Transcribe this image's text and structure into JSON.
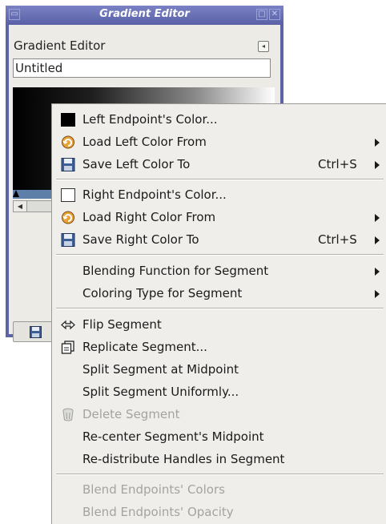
{
  "window": {
    "title": "Gradient Editor",
    "panel_label": "Gradient Editor",
    "name_value": "Untitled",
    "colors": {
      "titlebar": "#5c64a6",
      "title_text": "#ffffff",
      "handle_bar": "#5e7fa8"
    }
  },
  "menu": {
    "items": [
      {
        "label": "Left Endpoint's Color...",
        "icon": "black-swatch-icon"
      },
      {
        "label": "Load Left Color From",
        "icon": "load-icon",
        "submenu": true
      },
      {
        "label": "Save Left Color To",
        "icon": "save-icon",
        "accel": "Ctrl+S",
        "submenu": true
      },
      {
        "label": "Right Endpoint's Color...",
        "icon": "white-swatch-icon"
      },
      {
        "label": "Load Right Color From",
        "icon": "load-icon",
        "submenu": true
      },
      {
        "label": "Save Right Color To",
        "icon": "save-icon",
        "accel": "Ctrl+S",
        "submenu": true
      },
      {
        "label": "Blending Function for Segment",
        "submenu": true
      },
      {
        "label": "Coloring Type for Segment",
        "submenu": true
      },
      {
        "label": "Flip Segment",
        "icon": "flip-icon"
      },
      {
        "label": "Replicate Segment...",
        "icon": "replicate-icon"
      },
      {
        "label": "Split Segment at Midpoint"
      },
      {
        "label": "Split Segment Uniformly..."
      },
      {
        "label": "Delete Segment",
        "icon": "trash-icon",
        "disabled": true
      },
      {
        "label": "Re-center Segment's Midpoint"
      },
      {
        "label": "Re-distribute Handles in Segment"
      },
      {
        "label": "Blend Endpoints' Colors",
        "disabled": true
      },
      {
        "label": "Blend Endpoints' Opacity",
        "disabled": true
      }
    ]
  }
}
